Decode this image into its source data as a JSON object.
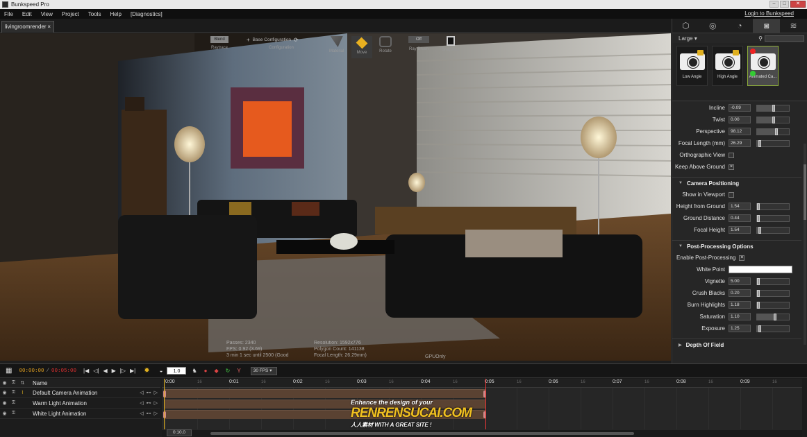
{
  "window": {
    "title": "Bunkspeed Pro"
  },
  "menu": {
    "items": [
      "File",
      "Edit",
      "View",
      "Project",
      "Tools",
      "Help",
      "[Diagnostics]"
    ],
    "login": "Login to Bunkspeed"
  },
  "doc_tab": {
    "label": "livingroomrender",
    "close": "×"
  },
  "viewport": {
    "blend_label": "Blend",
    "raytrace_label": "Raytrace",
    "config_label": "Base Configuration",
    "config_sub": "Configuration",
    "tools": [
      {
        "label": "Material",
        "icon": "material-icon"
      },
      {
        "label": "Move",
        "icon": "move-icon"
      },
      {
        "label": "Rotate",
        "icon": "rotate-icon"
      },
      {
        "label": "Ray Brush",
        "icon": "ray-brush-icon"
      },
      {
        "label": "Snapshot",
        "icon": "snapshot-icon"
      }
    ],
    "raybrush_state": "Off",
    "stats_left": [
      "Passes: 2340",
      "FPS: 0.92 (3.69)",
      "3 min 1 sec until 2500 (Good"
    ],
    "stats_mid": [
      "Resolution: 1592x776",
      "Polygon Count: 141138",
      "Focal Length: 26.29mm)"
    ],
    "stats_right": "GPUOnly"
  },
  "panel": {
    "size_select": "Large",
    "thumbs": [
      {
        "label": "Low Angle"
      },
      {
        "label": "High Angle"
      },
      {
        "label": "Animated Ca..."
      }
    ],
    "camera": [
      {
        "label": "Incline",
        "value": "-0.09",
        "level": 0.5
      },
      {
        "label": "Twist",
        "value": "0.00",
        "level": 0.5
      },
      {
        "label": "Perspective",
        "value": "98.12",
        "level": 0.58
      },
      {
        "label": "Focal Length (mm)",
        "value": "26.29",
        "level": 0.08
      }
    ],
    "ortho_label": "Orthographic View",
    "keep_above_label": "Keep Above Ground",
    "positioning_title": "Camera Positioning",
    "show_in_viewport_label": "Show in Viewport",
    "positioning": [
      {
        "label": "Height from Ground",
        "value": "1.54",
        "level": 0.03
      },
      {
        "label": "Ground Distance",
        "value": "0.44",
        "level": 0.03
      },
      {
        "label": "Focal Height",
        "value": "1.54",
        "level": 0.08
      }
    ],
    "post_title": "Post-Processing Options",
    "enable_post_label": "Enable Post-Processing",
    "white_point_label": "White Point",
    "post": [
      {
        "label": "Vignette",
        "value": "5.00",
        "level": 0.03
      },
      {
        "label": "Crush Blacks",
        "value": "0.20",
        "level": 0.03
      },
      {
        "label": "Burn Highlights",
        "value": "1.18",
        "level": 0.03
      },
      {
        "label": "Saturation",
        "value": "1.10",
        "level": 0.55
      },
      {
        "label": "Exposure",
        "value": "1.25",
        "level": 0.08
      }
    ],
    "dof_title": "Depth Of Field",
    "check_mark": "×"
  },
  "timeline": {
    "time_current": "00:00:00",
    "time_sep": "/",
    "time_total": "00:05:00",
    "speed": "1.0",
    "fps": "30 FPS",
    "name_header": "Name",
    "tracks": [
      "Default Camera Animation",
      "Warm Light Animation",
      "White Light Animation"
    ],
    "ruler": [
      "0:00",
      "0:01",
      "0:02",
      "0:03",
      "0:04",
      "0:05",
      "0:06",
      "0:07",
      "0:08",
      "0:09"
    ],
    "minor": "16",
    "bottom_value": "0:10.0"
  },
  "watermark": {
    "line1": "Enhance the design of your",
    "line2": "RENRENSUCAI.COM",
    "line3": "人人素材 WITH A GREAT SITE !"
  },
  "colors": {
    "accent_green": "#8fb03a",
    "time_orange": "#e0a020",
    "time_red": "#e03030",
    "track_bar": "#5a4232"
  }
}
